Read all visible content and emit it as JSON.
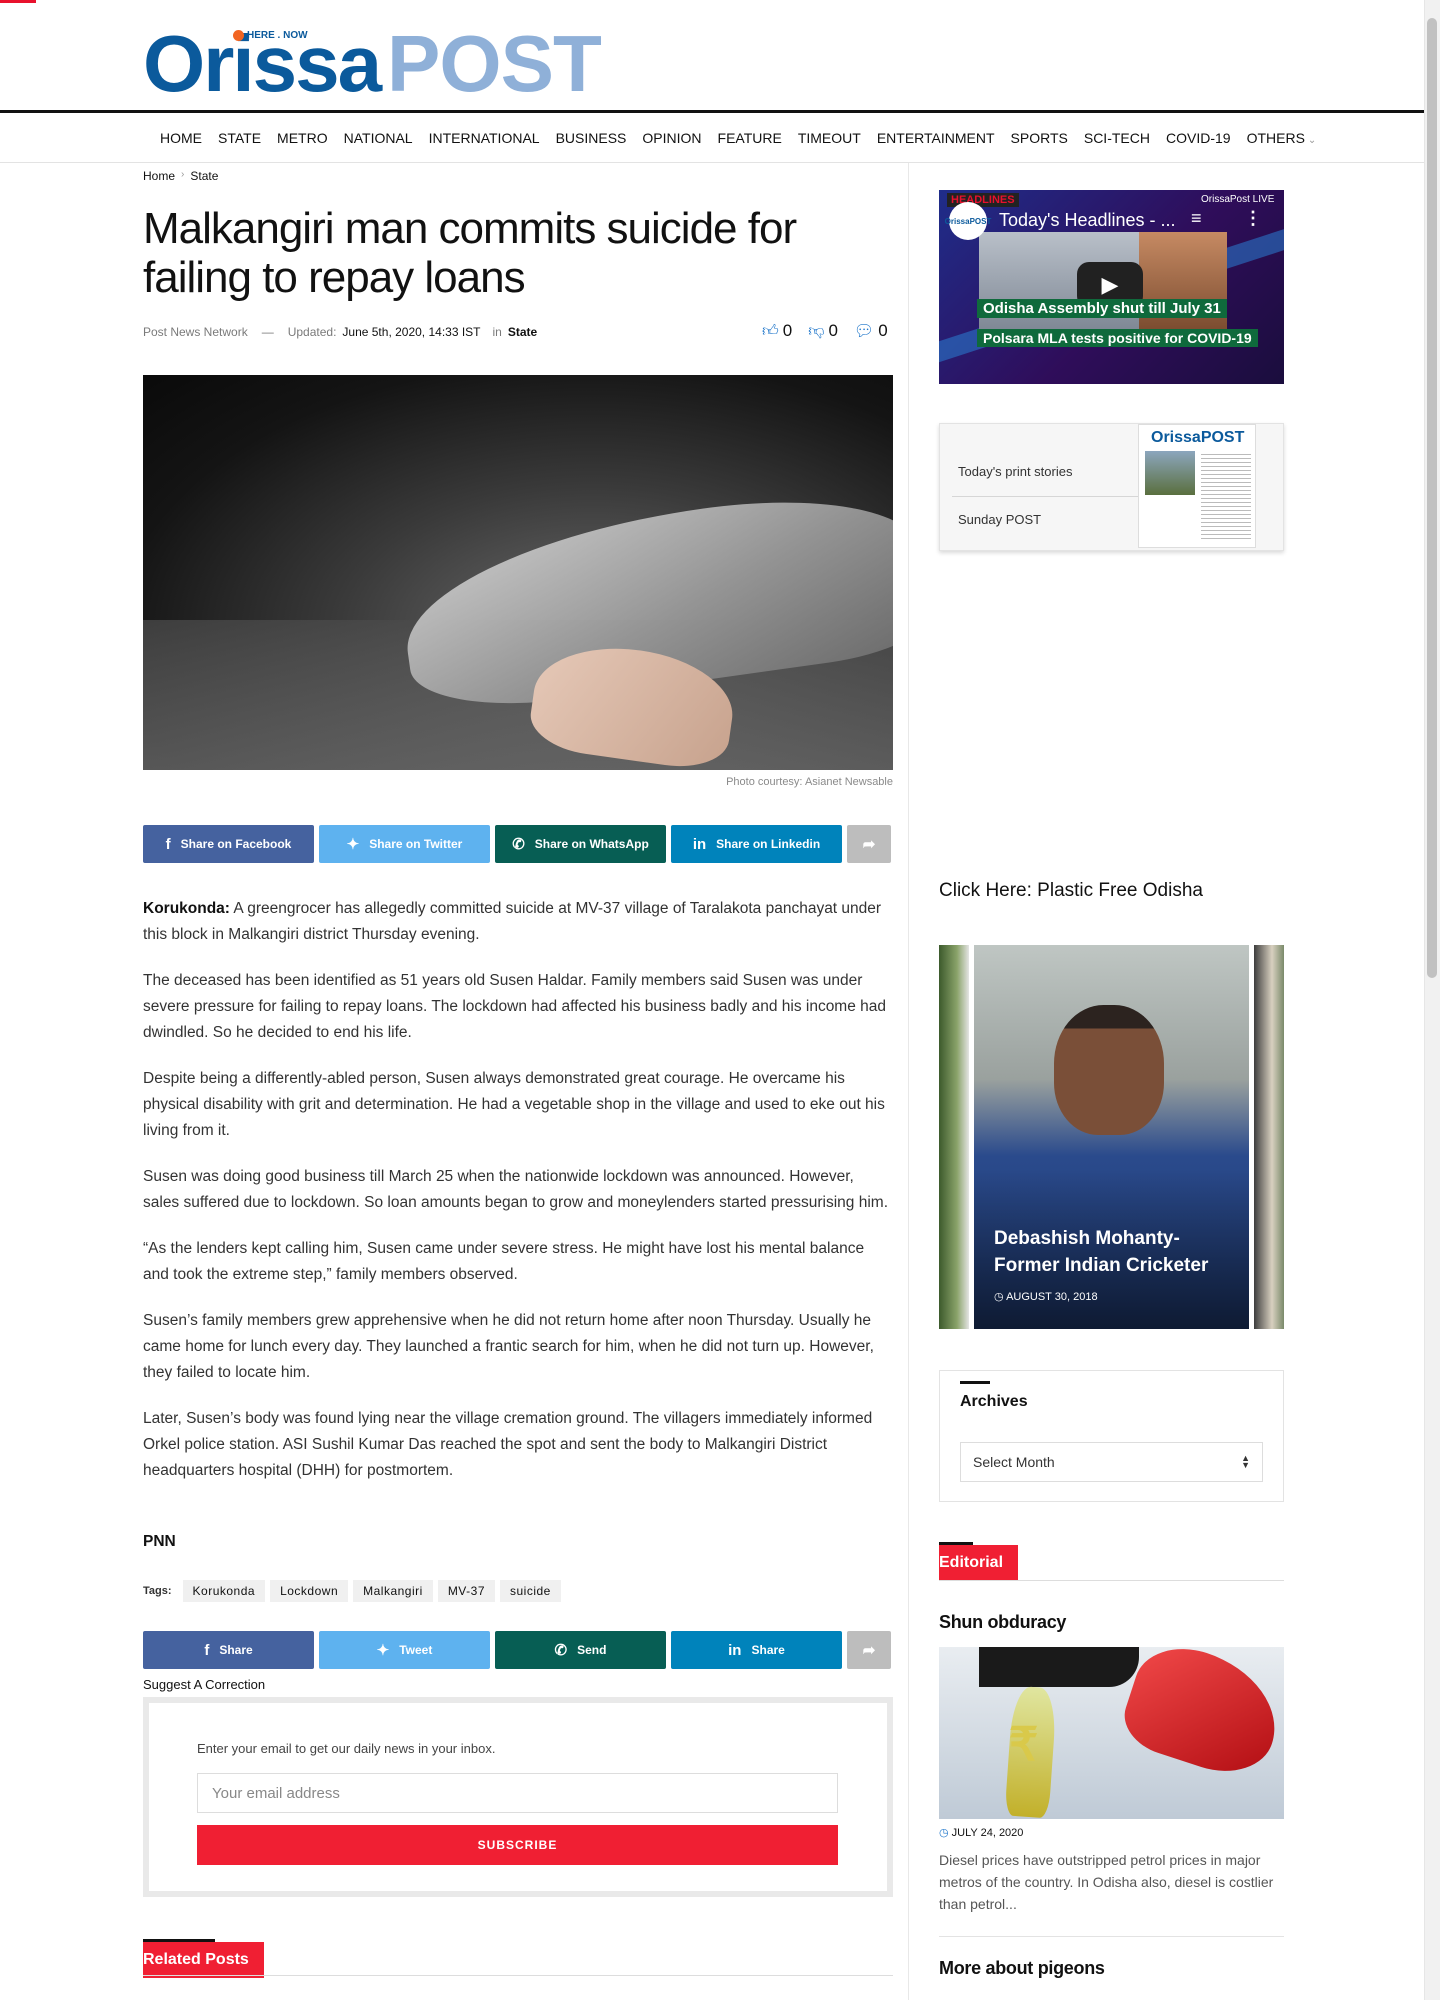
{
  "site": {
    "logo_main": "Orissa",
    "logo_post": "POST",
    "logo_tagline": "HERE . NOW"
  },
  "nav": {
    "items": [
      "HOME",
      "STATE",
      "METRO",
      "NATIONAL",
      "INTERNATIONAL",
      "BUSINESS",
      "OPINION",
      "FEATURE",
      "TIMEOUT",
      "ENTERTAINMENT",
      "SPORTS",
      "SCI-TECH",
      "COVID-19",
      "OTHERS"
    ]
  },
  "breadcrumb": {
    "home": "Home",
    "current": "State"
  },
  "article": {
    "title": "Malkangiri man commits suicide for failing to repay loans",
    "author": "Post News Network",
    "meta_separator": "—",
    "updated_label": "Updated:",
    "updated_value": "June 5th, 2020, 14:33 IST",
    "in_label": "in",
    "category": "State",
    "likes": "0",
    "dislikes": "0",
    "comments": "0",
    "image_caption": "Photo courtesy: Asianet Newsable",
    "lead_location": "Korukonda:",
    "paragraphs": [
      " A greengrocer has allegedly committed suicide at MV-37 village of Taralakota panchayat under this block in Malkangiri district Thursday evening.",
      "The deceased has been identified as 51 years old Susen Haldar. Family members said Susen was under severe pressure for failing to repay loans. The lockdown had affected his business badly and his income had dwindled. So he decided to end his life.",
      "Despite being a differently-abled person, Susen always demonstrated great courage. He overcame his physical disability with grit and determination. He had a vegetable shop in the village and used to eke out his living from it.",
      "Susen was doing good business till March 25 when the nationwide lockdown was announced. However, sales suffered due to lockdown. So loan amounts began to grow and moneylenders started pressurising him.",
      "“As the lenders kept calling him, Susen came under severe stress. He might have lost his mental balance and took the extreme step,” family members observed.",
      "Susen’s family members grew apprehensive when he did not return home after noon Thursday. Usually he came home for lunch every day. They launched a frantic search for him, when he did not turn up. However, they failed to locate him.",
      "Later, Susen’s body was found lying near the village cremation ground. The villagers immediately informed Orkel police station. ASI Sushil Kumar Das reached the spot and sent the body to Malkangiri District headquarters hospital (DHH) for postmortem."
    ],
    "signoff": "PNN",
    "tags_label": "Tags:",
    "tags": [
      "Korukonda",
      "Lockdown",
      "Malkangiri",
      "MV-37",
      "suicide"
    ]
  },
  "share_top": {
    "facebook": "Share on Facebook",
    "twitter": "Share on Twitter",
    "whatsapp": "Share on WhatsApp",
    "linkedin": "Share on Linkedin"
  },
  "share_bottom": {
    "facebook": "Share",
    "twitter": "Tweet",
    "whatsapp": "Send",
    "linkedin": "Share"
  },
  "suggest_correction": "Suggest A Correction",
  "newsletter": {
    "text": "Enter your email to get our daily news in your inbox.",
    "placeholder": "Your email address",
    "button": "SUBSCRIBE"
  },
  "related_posts_label": "Related Posts",
  "sidebar": {
    "video": {
      "badge": "HEADLINES",
      "brand": "OrissaPost LIVE",
      "channel_avatar": "OrissaPOST",
      "title": "Today's Headlines - ...",
      "caption1": "Odisha Assembly shut till July 31",
      "caption2": "Polsara MLA tests positive for COVID-19"
    },
    "print": {
      "paper_title": "OrissaPOST",
      "item1": "Today's print stories",
      "item2": "Sunday POST"
    },
    "plastic_free": "Click Here: Plastic Free Odisha",
    "slider": {
      "title": "Debashish Mohanty- Former Indian Cricketer",
      "date": "AUGUST 30, 2018"
    },
    "archives": {
      "title": "Archives",
      "select_value": "Select Month"
    },
    "editorial": {
      "label": "Editorial",
      "post1_title": "Shun obduracy",
      "post1_date": "JULY 24, 2020",
      "post1_excerpt": "Diesel prices have outstripped petrol prices in major metros of the country. In Odisha also, diesel is costlier than petrol...",
      "post2_title": "More about pigeons"
    }
  },
  "colors": {
    "accent_red": "#f01f33",
    "logo_blue": "#0b5a9c",
    "facebook": "#45629f",
    "twitter": "#5eb2ef",
    "whatsapp": "#075e54",
    "linkedin": "#0083bb"
  }
}
